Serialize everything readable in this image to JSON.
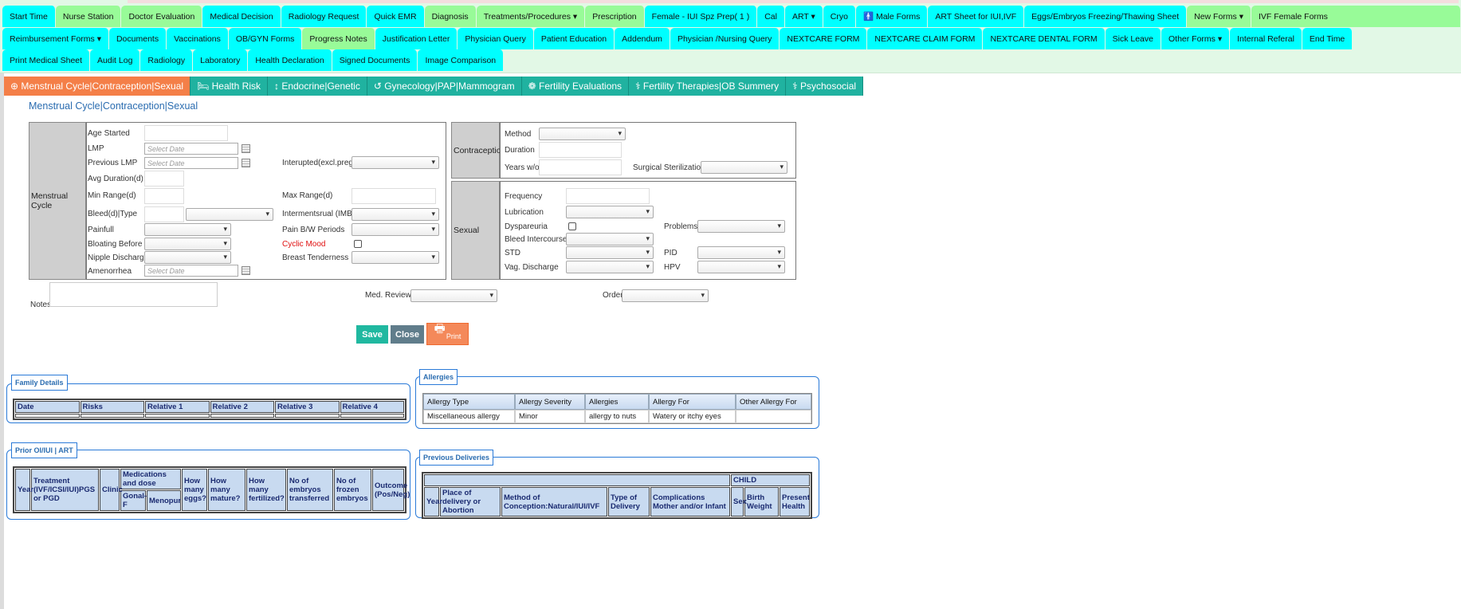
{
  "nav_rows": [
    [
      {
        "label": "Start Time",
        "c": "cy"
      },
      {
        "label": "Nurse Station",
        "c": "gr"
      },
      {
        "label": "Doctor Evaluation",
        "c": "gr"
      },
      {
        "label": "Medical Decision",
        "c": "cy"
      },
      {
        "label": "Radiology Request",
        "c": "cy"
      },
      {
        "label": "Quick EMR",
        "c": "cy"
      },
      {
        "label": "Diagnosis",
        "c": "gr"
      },
      {
        "label": "Treatments/Procedures ▾",
        "c": "gr"
      },
      {
        "label": "Prescription",
        "c": "gr"
      },
      {
        "label": "Female - IUI Spz Prep( 1 )",
        "c": "cy"
      },
      {
        "label": "Cal",
        "c": "cy"
      },
      {
        "label": "ART ▾",
        "c": "cy"
      },
      {
        "label": "Cryo",
        "c": "cy"
      },
      {
        "label": "🚹 Male Forms",
        "c": "cy"
      },
      {
        "label": "ART Sheet for IUI,IVF",
        "c": "cy"
      },
      {
        "label": "Eggs/Embryos Freezing/Thawing Sheet",
        "c": "cy"
      },
      {
        "label": "New Forms ▾",
        "c": "gr"
      },
      {
        "label": "IVF Female Forms",
        "c": "gr"
      }
    ],
    [
      {
        "label": "Reimbursement Forms ▾",
        "c": "cy"
      },
      {
        "label": "Documents",
        "c": "cy"
      },
      {
        "label": "Vaccinations",
        "c": "cy"
      },
      {
        "label": "OB/GYN Forms",
        "c": "cy"
      },
      {
        "label": "Progress Notes",
        "c": "gr"
      },
      {
        "label": "Justification Letter",
        "c": "cy"
      },
      {
        "label": "Physician Query",
        "c": "cy"
      },
      {
        "label": "Patient Education",
        "c": "cy"
      },
      {
        "label": "Addendum",
        "c": "cy"
      },
      {
        "label": "Physician /Nursing Query",
        "c": "cy"
      },
      {
        "label": "NEXTCARE FORM",
        "c": "cy"
      },
      {
        "label": "NEXTCARE CLAIM FORM",
        "c": "cy"
      },
      {
        "label": "NEXTCARE DENTAL FORM",
        "c": "cy"
      },
      {
        "label": "Sick Leave",
        "c": "cy"
      },
      {
        "label": "Other Forms ▾",
        "c": "cy"
      },
      {
        "label": "Internal Referal",
        "c": "cy"
      },
      {
        "label": "End Time",
        "c": "cy"
      }
    ],
    [
      {
        "label": "Print Medical Sheet",
        "c": "cy"
      },
      {
        "label": "Audit Log",
        "c": "cy"
      },
      {
        "label": "Radiology",
        "c": "cy"
      },
      {
        "label": "Laboratory",
        "c": "cy"
      },
      {
        "label": "Health Declaration",
        "c": "cy"
      },
      {
        "label": "Signed Documents",
        "c": "cy"
      },
      {
        "label": "Image Comparison",
        "c": "cy"
      }
    ]
  ],
  "subtabs": [
    {
      "label": "⊕ Menstrual Cycle|Contraception|Sexual",
      "active": true
    },
    {
      "label": "🛏 Health Risk"
    },
    {
      "label": "↕ Endocrine|Genetic"
    },
    {
      "label": "↺ Gynecology|PAP|Mammogram"
    },
    {
      "label": "❁ Fertility Evaluations"
    },
    {
      "label": "⚕ Fertility Therapies|OB Summery"
    },
    {
      "label": "⚕ Psychosocial"
    }
  ],
  "page_title": "Menstrual Cycle|Contraception|Sexual",
  "menstrual": {
    "section": "Menstrual Cycle",
    "age_started": "Age Started",
    "lmp": "LMP",
    "previous_lmp": "Previous LMP",
    "date_placeholder": "Select Date",
    "interrupted": "Interupted(excl.preg)",
    "avg_duration": "Avg Duration(d)",
    "min_range": "Min Range(d)",
    "max_range": "Max Range(d)",
    "bleed_type": "Bleed(d)|Type",
    "intermenstrual": "Intermentsrual (IMB)",
    "painfull": "Painfull",
    "pain_bw": "Pain B/W Periods",
    "bloating": "Bloating Before",
    "cyclic_mood": "Cyclic Mood",
    "nipple": "Nipple Discharge",
    "breast": "Breast Tenderness",
    "amenorrhea": "Amenorrhea"
  },
  "contraception": {
    "section": "Contraception",
    "method": "Method",
    "duration": "Duration",
    "years_wo": "Years w/o",
    "surgical": "Surgical Sterilization"
  },
  "sexual": {
    "section": "Sexual",
    "frequency": "Frequency",
    "lubrication": "Lubrication",
    "dyspareuria": "Dyspareuria",
    "problems": "Problems",
    "bleed_intercourse": "Bleed Intercourse",
    "std": "STD",
    "pid": "PID",
    "vag_discharge": "Vag. Discharge",
    "hpv": "HPV"
  },
  "notes_label": "Notes",
  "med_review": "Med. Review",
  "order": "Order",
  "buttons": {
    "save": "Save",
    "close": "Close",
    "print": "Print"
  },
  "family": {
    "legend": "Family Details",
    "headers": [
      "Date",
      "Risks",
      "Relative 1",
      "Relative 2",
      "Relative 3",
      "Relative 4"
    ]
  },
  "allergies": {
    "legend": "Allergies",
    "headers": [
      "Allergy Type",
      "Allergy Severity",
      "Allergies",
      "Allergy For",
      "Other Allergy For"
    ],
    "rows": [
      [
        "Miscellaneous allergy",
        "Minor",
        "allergy to nuts",
        "Watery or itchy eyes",
        ""
      ]
    ]
  },
  "prior": {
    "legend": "Prior OI/IUI | ART",
    "headers": {
      "year": "Year",
      "treatment": "Treatment (IVF/ICSI/IUI)PGS or PGD",
      "clinic": "Clinic",
      "meds": "Medications and dose",
      "gonal": "Gonal-F",
      "menopur": "Menopur",
      "eggs": "How many eggs?",
      "mature": "How many mature?",
      "fertilized": "How many fertilized?",
      "transferred": "No of embryos transferred",
      "frozen": "No of frozen embryos",
      "outcome": "Outcome (Pos/Neg)"
    }
  },
  "deliveries": {
    "legend": "Previous Deliveries",
    "child": "CHILD",
    "headers": [
      "Year",
      "Place of delivery or Abortion",
      "Method of Conception:Natural/IUI/IVF",
      "Type of Delivery",
      "Complications Mother and/or Infant",
      "Sex",
      "Birth Weight",
      "Present Health"
    ]
  }
}
